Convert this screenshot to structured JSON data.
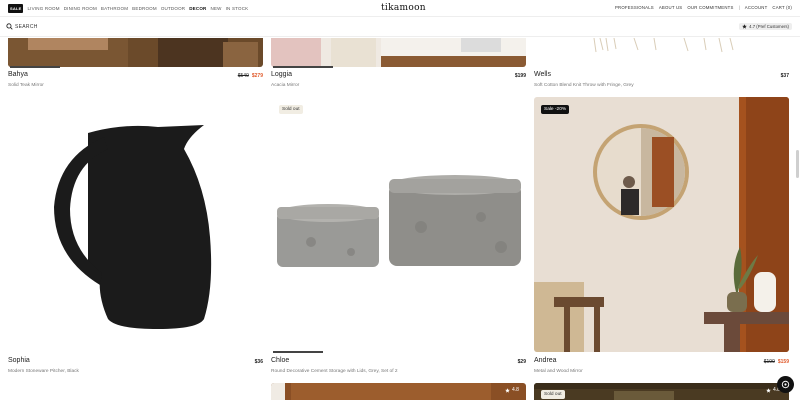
{
  "nav": {
    "sale": "SALE",
    "links": [
      "LIVING ROOM",
      "DINING ROOM",
      "BATHROOM",
      "BEDROOM",
      "OUTDOOR",
      "DECOR",
      "NEW",
      "IN STOCK"
    ],
    "logo": "tikamoon",
    "right": [
      "PROFESSIONALS",
      "ABOUT US",
      "OUR COMMITMENTS",
      "ACCOUNT",
      "CART (0)"
    ],
    "separator": "|"
  },
  "search": {
    "label": "SEARCH",
    "rating": "4.7 (Pref Customers)"
  },
  "products": [
    {
      "name": "Bahya",
      "sub": "Solid Teak Mirror",
      "old": "$549",
      "price": "$279"
    },
    {
      "name": "Loggia",
      "sub": "Acacia Mirror",
      "price": "$199"
    },
    {
      "name": "Wells",
      "sub": "Soft Cotton Blend Knit Throw with Fringe, Grey",
      "price": "$37"
    },
    {
      "name": "Sophia",
      "sub": "Modern Stoneware Pitcher, Black",
      "price": "$36"
    },
    {
      "name": "Chloe",
      "sub": "Round Decorative Cement Storage with Lids, Grey, Set of 2",
      "price": "$29",
      "badge": "Sold out"
    },
    {
      "name": "Andrea",
      "sub": "Metal and Wood Mirror",
      "old": "$199",
      "price": "$159",
      "badge": "Sale -20%"
    }
  ],
  "bottom_row": {
    "rating_mid": "4.8",
    "rating_right": "4.8",
    "badge_right": "Sold out"
  },
  "icons": {
    "search": "search-icon",
    "star": "star-icon",
    "chat": "chat-icon"
  }
}
